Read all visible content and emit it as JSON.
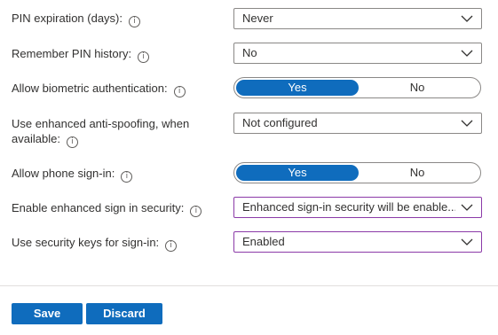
{
  "fields": [
    {
      "label": "PIN expiration (days):",
      "control": "dropdown",
      "value": "Never"
    },
    {
      "label": "Remember PIN history:",
      "control": "dropdown",
      "value": "No"
    },
    {
      "label": "Allow biometric authentication:",
      "control": "toggle",
      "on_label": "Yes",
      "off_label": "No",
      "selected": "Yes"
    },
    {
      "label_line1": "Use enhanced anti-spoofing, when",
      "label_line2": "available:",
      "control": "dropdown",
      "value": "Not configured"
    },
    {
      "label": "Allow phone sign-in:",
      "control": "toggle",
      "on_label": "Yes",
      "off_label": "No",
      "selected": "Yes"
    },
    {
      "label": "Enable enhanced sign in security:",
      "control": "dropdown",
      "value": "Enhanced sign-in security will be enable..."
    },
    {
      "label": "Use security keys for sign-in:",
      "control": "dropdown",
      "value": "Enabled"
    }
  ],
  "info_glyph": "i",
  "actions": {
    "save_label": "Save",
    "discard_label": "Discard"
  },
  "colors": {
    "accent": "#0f6cbd",
    "modified_border": "#8b3aa8",
    "border": "#8a8886"
  },
  "icons": {
    "info": "info-icon",
    "dropdown": "chevron-down-icon"
  }
}
